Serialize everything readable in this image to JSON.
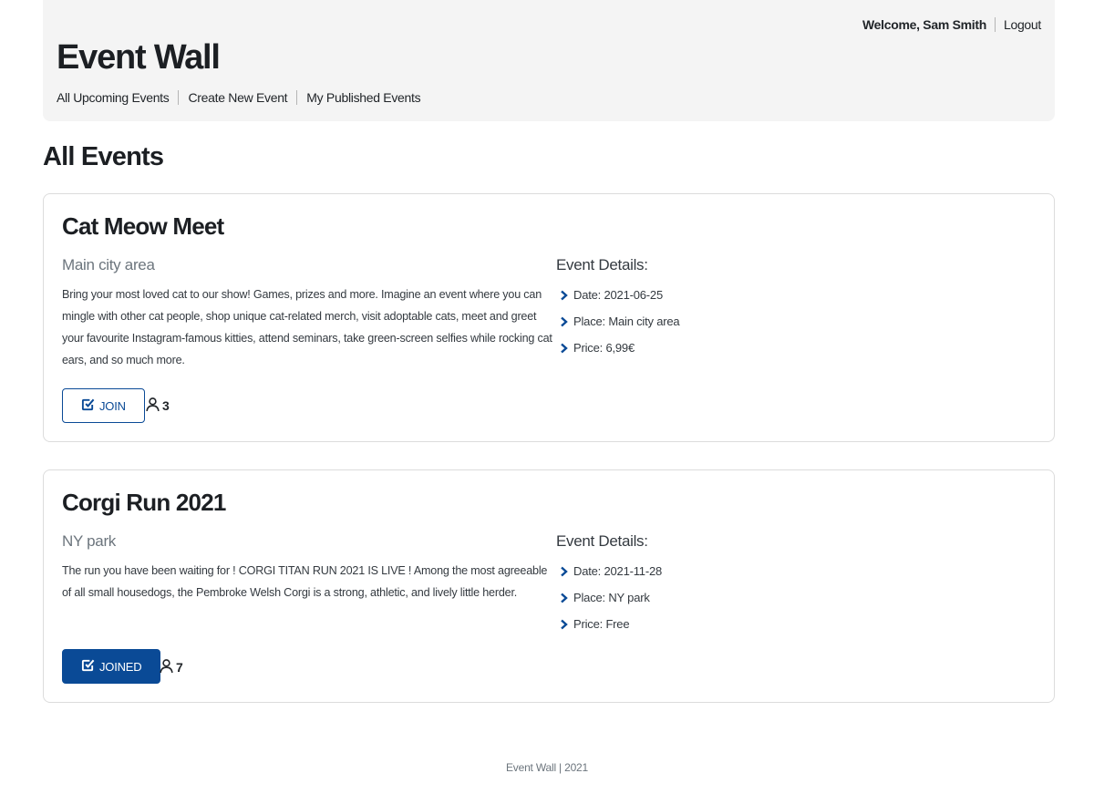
{
  "header": {
    "welcome": "Welcome, Sam Smith",
    "logout": "Logout",
    "brand": "Event Wall",
    "nav": [
      "All Upcoming Events",
      "Create New Event",
      "My Published Events"
    ]
  },
  "page_title": "All Events",
  "details_heading": "Event Details:",
  "events": [
    {
      "title": "Cat Meow Meet",
      "place": "Main city area",
      "description": "Bring your most loved cat to our show! Games, prizes and more. Imagine an event where you can mingle with other cat people, shop unique cat-related merch, visit adoptable cats, meet and greet your favourite Instagram-famous kitties, attend seminars, take green-screen selfies while rocking cat ears, and so much more.",
      "details": [
        "Date: 2021-06-25",
        "Place: Main city area",
        "Price: 6,99€"
      ],
      "button_label": "JOIN",
      "joined": false,
      "attendee_count": "3"
    },
    {
      "title": "Corgi Run 2021",
      "place": "NY park",
      "description": "The run you have been waiting for ! CORGI TITAN RUN 2021 IS LIVE ! Among the most agreeable of all small housedogs, the Pembroke Welsh Corgi is a strong, athletic, and lively little herder.",
      "details": [
        "Date: 2021-11-28",
        "Place: NY park",
        "Price: Free"
      ],
      "button_label": "JOINED",
      "joined": true,
      "attendee_count": "7"
    }
  ],
  "footer": "Event Wall | 2021",
  "colors": {
    "accent": "#0a4a96",
    "header_bg": "#f4f4f4",
    "muted_text": "#6c757d",
    "card_border": "#dcdcdc"
  },
  "icons": {
    "details_bullet": "chevron-right-icon",
    "join_button": "check-square-icon",
    "attendees": "person-icon"
  }
}
